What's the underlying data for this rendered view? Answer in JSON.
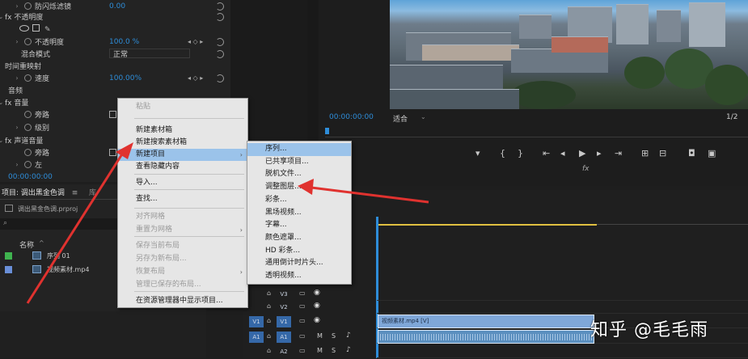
{
  "effects": {
    "rows": [
      {
        "twirl": "›",
        "label": "防闪烁滤镜",
        "value": "0.00",
        "indent": 30
      },
      {
        "twirl": "⌄",
        "label": "fx 不透明度",
        "value": "",
        "indent": 10
      },
      {
        "twirl": "",
        "label": "",
        "value": "",
        "indent": 20
      },
      {
        "twirl": "›",
        "label": "不透明度",
        "value": "100.0 %",
        "indent": 30
      },
      {
        "twirl": "",
        "label": "混合模式",
        "value": "正常",
        "indent": 30
      },
      {
        "twirl": "",
        "label": "时间重映射",
        "value": "",
        "indent": 10
      },
      {
        "twirl": "›",
        "label": "速度",
        "value": "100.00%",
        "indent": 30
      },
      {
        "twirl": "",
        "label": "音频",
        "value": "",
        "indent": 0
      },
      {
        "twirl": "⌄",
        "label": "fx 音量",
        "value": "",
        "indent": 10
      },
      {
        "twirl": "",
        "label": "旁路",
        "value": "",
        "indent": 30
      },
      {
        "twirl": "›",
        "label": "级别",
        "value": "",
        "indent": 30
      },
      {
        "twirl": "⌄",
        "label": "fx 声道音量",
        "value": "",
        "indent": 10
      },
      {
        "twirl": "",
        "label": "旁路",
        "value": "",
        "indent": 30
      },
      {
        "twirl": "›",
        "label": "左",
        "value": "",
        "indent": 30
      },
      {
        "twirl": "",
        "label": "00:00:00:00",
        "value": "",
        "indent": 0
      }
    ]
  },
  "project": {
    "tab": "项目: 调出黑金色调",
    "tab2": "库",
    "file": "调出黑金色调.prproj",
    "search_icon": "search-icon",
    "column_name": "名称",
    "items": [
      {
        "name": "序列 01",
        "color": "#3fb34f"
      },
      {
        "name": "视频素材.mp4",
        "color": "#6a8fd8"
      }
    ]
  },
  "monitor": {
    "timecode": "00:00:00:00",
    "fit": "适合",
    "fraction": "1/2"
  },
  "context_menu": {
    "items": [
      {
        "label": "粘贴",
        "disabled": true
      },
      {
        "label": "新建素材箱",
        "disabled": false
      },
      {
        "label": "新建搜索素材箱",
        "disabled": false
      },
      {
        "label": "新建项目",
        "disabled": false,
        "highlight": true,
        "submenu": true
      },
      {
        "label": "查看隐藏内容",
        "disabled": false
      },
      {
        "label": "导入...",
        "disabled": false
      },
      {
        "label": "查找...",
        "disabled": false
      },
      {
        "label": "对齐网格",
        "disabled": true
      },
      {
        "label": "重置为网格",
        "disabled": true,
        "submenu": true
      },
      {
        "label": "保存当前布局",
        "disabled": true
      },
      {
        "label": "另存为新布局...",
        "disabled": true
      },
      {
        "label": "恢复布局",
        "disabled": true,
        "submenu": true
      },
      {
        "label": "管理已保存的布局...",
        "disabled": true
      },
      {
        "label": "在资源管理器中显示项目...",
        "disabled": false
      }
    ]
  },
  "submenu": {
    "items": [
      {
        "label": "序列...",
        "highlight": true
      },
      {
        "label": "已共享项目..."
      },
      {
        "label": "脱机文件..."
      },
      {
        "label": "调整图层..."
      },
      {
        "label": "彩条..."
      },
      {
        "label": "黑场视频..."
      },
      {
        "label": "字幕..."
      },
      {
        "label": "颜色遮罩..."
      },
      {
        "label": "HD 彩条..."
      },
      {
        "label": "通用倒计时片头..."
      },
      {
        "label": "透明视频..."
      }
    ]
  },
  "timeline": {
    "tracks": [
      {
        "id": "V3",
        "type": "video"
      },
      {
        "id": "V2",
        "type": "video"
      },
      {
        "id": "V1",
        "type": "video",
        "src": "V1"
      },
      {
        "id": "A1",
        "type": "audio",
        "src": "A1"
      },
      {
        "id": "A2",
        "type": "audio"
      }
    ],
    "clip_label": "视频素材.mp4 [V]",
    "fx_label": "fx",
    "m_label": "M",
    "s_label": "S"
  },
  "watermark": "知乎 @毛毛雨",
  "colors": {
    "accent_blue": "#2e8dd9",
    "menu_highlight": "#9bc3ea",
    "clip_video": "#7fa7d8",
    "arrow_red": "#e0322f"
  }
}
